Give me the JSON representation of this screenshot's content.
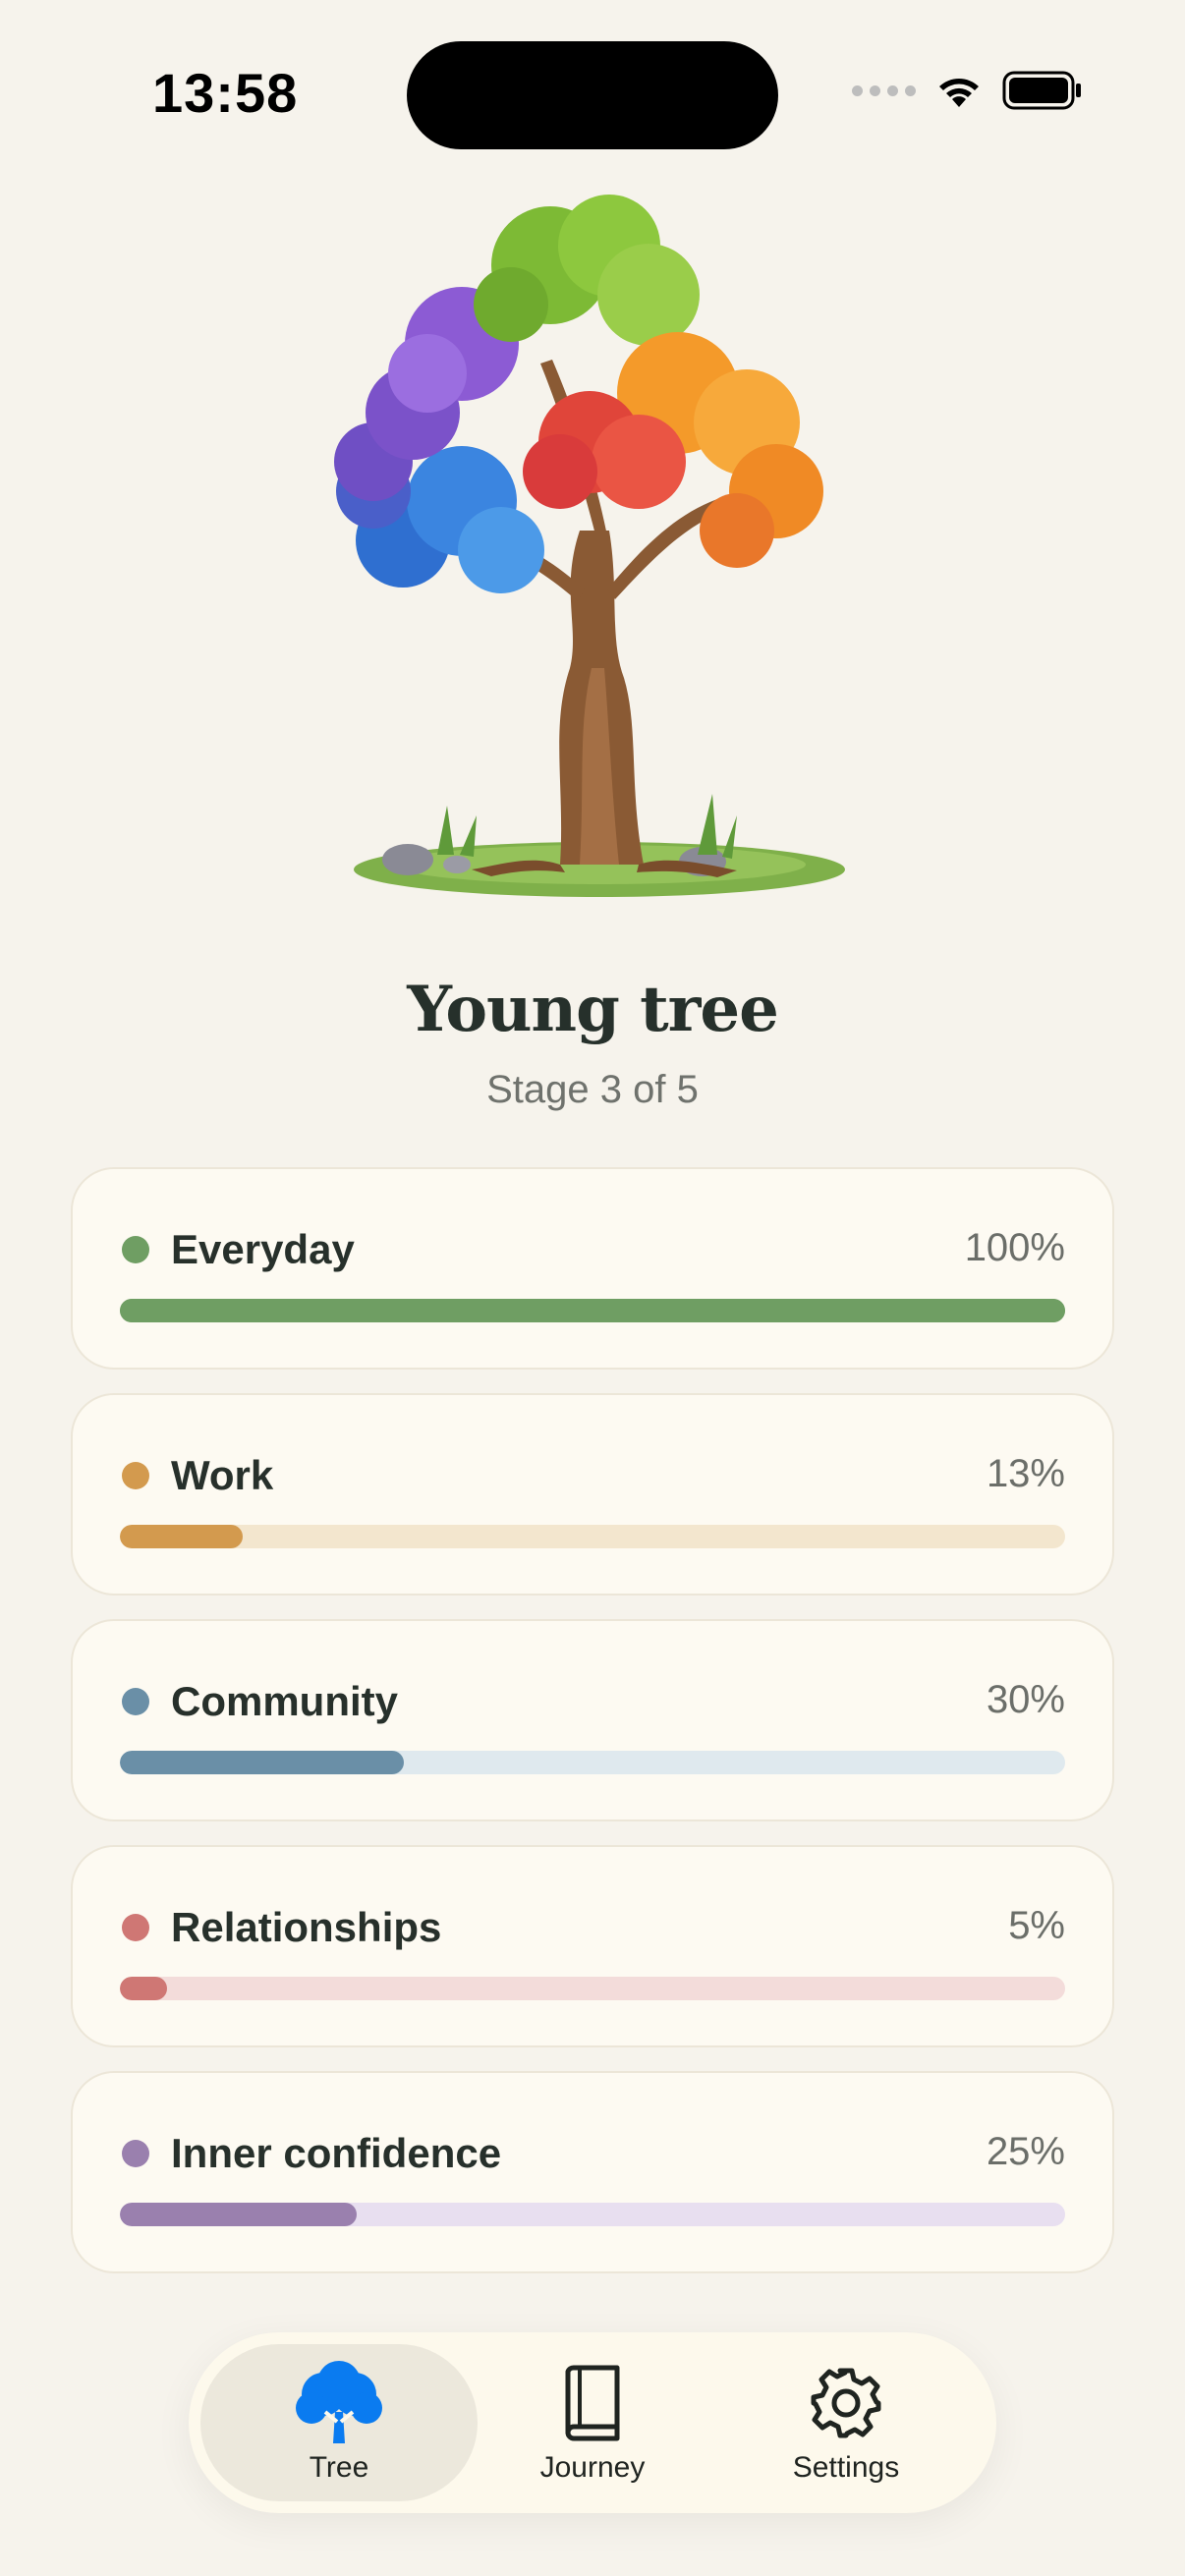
{
  "status_bar": {
    "time": "13:58"
  },
  "hero": {
    "title": "Young tree",
    "subtitle": "Stage 3 of 5"
  },
  "categories": [
    {
      "label": "Everyday",
      "percent_text": "100%",
      "progress": 1.0,
      "color": "#6f9e63",
      "track": "#6f9e63"
    },
    {
      "label": "Work",
      "percent_text": "13%",
      "progress": 0.13,
      "color": "#d39a4e",
      "track": "#f3e6ce"
    },
    {
      "label": "Community",
      "percent_text": "30%",
      "progress": 0.3,
      "color": "#6a8fa7",
      "track": "#dfe9ee"
    },
    {
      "label": "Relationships",
      "percent_text": "5%",
      "progress": 0.05,
      "color": "#cf7774",
      "track": "#f3dcda"
    },
    {
      "label": "Inner confidence",
      "percent_text": "25%",
      "progress": 0.25,
      "color": "#9a80ae",
      "track": "#e8dff0"
    }
  ],
  "tabbar": {
    "tabs": [
      {
        "label": "Tree",
        "icon": "tree-icon",
        "active": true
      },
      {
        "label": "Journey",
        "icon": "book-icon",
        "active": false
      },
      {
        "label": "Settings",
        "icon": "gear-icon",
        "active": false
      }
    ]
  },
  "colors": {
    "background": "#f6f3ec",
    "card": "#fdfaf2",
    "accent_blue": "#0a7bf0"
  }
}
